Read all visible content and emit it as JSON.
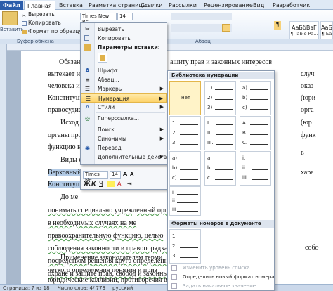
{
  "tabs": [
    "Файл",
    "Главная",
    "Вставка",
    "Разметка страницы",
    "Ссылки",
    "Рассылки",
    "Рецензирование",
    "Вид",
    "Разработчик"
  ],
  "clipboard": {
    "paste": "Вставить",
    "cut": "Вырезать",
    "copy": "Копировать",
    "format_painter": "Формат по образцу",
    "group": "Буфер обмена"
  },
  "font": {
    "name": "Times New Rc",
    "size": "14"
  },
  "paragraph_group": "Абзац",
  "styles": [
    {
      "sample": "АаБбВвГ",
      "label": "¶ Table Pa..."
    },
    {
      "sample": "АаБ",
      "label": "¶ Ба"
    }
  ],
  "doc_lines": {
    "l1": "Обязан",
    "l1r": "ащиту прав и законных интересов",
    "l2": "вытекает из",
    "l3": "человека и г",
    "l4": "Конституци",
    "l5": "правосудие.",
    "l6": "Исход",
    "l7": "органы пров",
    "l8": "функцию на",
    "l9": "Виды с",
    "l10": "Верховный",
    "l11": "Конституци",
    "l12": "До ме",
    "l13": "понимать специально учрежденный орган г",
    "l14": "в необходимых случаях на ме",
    "l15": "правоохранительную функцию, целью",
    "l16": "соблюдения законности и правопорядка",
    "l17": "посредством решения круга определенн",
    "l18": "охране и защите прав, свобод и законных и",
    "l19": "Применение законодателем терми",
    "l20": "четкого определения понятия и приз",
    "l21": "юридические коллизии, противоречия в де",
    "r1": "случ",
    "r2": "оказ",
    "r3": "(юри",
    "r4": "орга",
    "r5": "(юр",
    "r6": "функ",
    "r7": "в",
    "r8": "хара",
    "r9": "собо"
  },
  "context_menu": {
    "items": [
      {
        "label": "Вырезать",
        "icon": "scissors-icon"
      },
      {
        "label": "Копировать",
        "icon": "copy-icon"
      },
      {
        "label": "Параметры вставки:",
        "icon": "paste-icon"
      },
      {
        "label": "Шрифт...",
        "icon": "font-icon"
      },
      {
        "label": "Абзац...",
        "icon": "paragraph-icon"
      },
      {
        "label": "Маркеры",
        "icon": "bullets-icon"
      },
      {
        "label": "Нумерация",
        "icon": "numbering-icon"
      },
      {
        "label": "Стили",
        "icon": "styles-icon"
      },
      {
        "label": "Гиперссылка...",
        "icon": "hyperlink-icon"
      },
      {
        "label": "Поиск",
        "icon": "search-icon"
      },
      {
        "label": "Синонимы",
        "icon": "synonyms-icon"
      },
      {
        "label": "Перевод",
        "icon": "translate-icon"
      },
      {
        "label": "Дополнительные действия",
        "icon": "actions-icon"
      }
    ]
  },
  "mini_toolbar": {
    "font": "Times Ne",
    "size": "14"
  },
  "numbering": {
    "library_title": "Библиотека нумерации",
    "none": "нет",
    "doc_title": "Форматы номеров в документе",
    "formats": [
      [
        "1)",
        "2)",
        "3)"
      ],
      [
        "a)",
        "b)",
        "c)"
      ],
      [
        "1.",
        "2.",
        "3."
      ],
      [
        "I.",
        "II.",
        "III."
      ],
      [
        "A.",
        "B.",
        "C."
      ],
      [
        "a)",
        "b)",
        "c)"
      ],
      [
        "a.",
        "b.",
        "c."
      ],
      [
        "i.",
        "ii.",
        "iii."
      ],
      [
        "1.",
        "2.",
        "3."
      ]
    ],
    "footer": [
      "Изменить уровень списка",
      "Определить новый формат номера...",
      "Задать начальное значение..."
    ]
  },
  "status": {
    "page": "Страница: 7 из 18",
    "words": "Число слов: 4/ 773",
    "lang": "русский"
  }
}
